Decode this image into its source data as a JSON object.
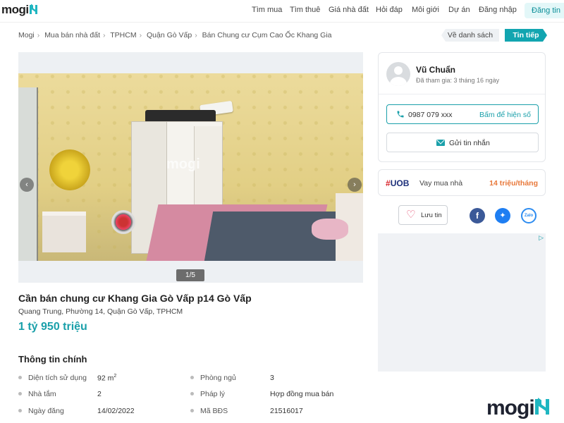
{
  "header": {
    "logo": "mogi",
    "nav": [
      "Tìm mua",
      "Tìm thuê",
      "Giá nhà đất",
      "Hỏi đáp",
      "Môi giới",
      "Dự án",
      "Đăng nhập"
    ],
    "post_button": "Đăng tin"
  },
  "breadcrumb": [
    "Mogi",
    "Mua bán nhà đất",
    "TPHCM",
    "Quận Gò Vấp",
    "Bán Chung cư Cụm Cao Ốc Khang Gia"
  ],
  "actions": {
    "back_to_list": "Về danh sách",
    "next": "Tin tiếp"
  },
  "gallery": {
    "counter": "1/5",
    "watermark": "mogi",
    "prev": "‹",
    "next": "›"
  },
  "listing": {
    "title": "Cần bán chung cư Khang Gia Gò Vấp p14 Gò Vấp",
    "address": "Quang Trung, Phường 14, Quận Gò Vấp, TPHCM",
    "price": "1 tỷ 950 triệu"
  },
  "main_info": {
    "title": "Thông tin chính",
    "rows": [
      {
        "label": "Diện tích sử dụng",
        "value": "92 m",
        "label2": "Phòng ngủ",
        "value2": "3"
      },
      {
        "label": "Nhà tắm",
        "value": "2",
        "label2": "Pháp lý",
        "value2": "Hợp đồng mua bán"
      },
      {
        "label": "Ngày đăng",
        "value": "14/02/2022",
        "label2": "Mã BĐS",
        "value2": "21516017"
      }
    ],
    "area_superscript": "2"
  },
  "agent": {
    "name": "Vũ Chuẩn",
    "joined": "Đã tham gia: 3 tháng 16 ngày",
    "phone": "0987 079 xxx",
    "reveal": "Bấm để hiện số",
    "message": "Gửi tin nhắn"
  },
  "loan": {
    "bank": "UOB",
    "text": "Vay mua nhà",
    "rate": "14 triệu/tháng"
  },
  "save": {
    "label": "Lưu tin"
  },
  "share": {
    "facebook": "f",
    "messenger": "✦",
    "zalo": "Zalo"
  },
  "ad": {
    "mark": "▷"
  },
  "footer_logo": "mogi",
  "colors": {
    "brand": "#1aa0aa",
    "accent": "#e8783a"
  }
}
